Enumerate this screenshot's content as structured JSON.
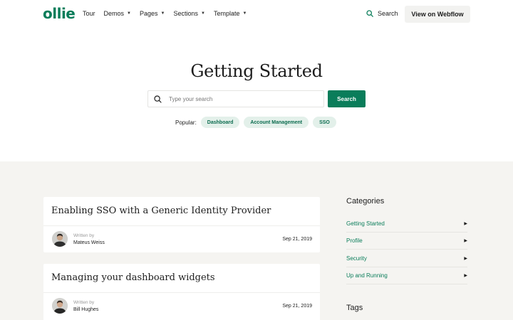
{
  "nav": {
    "logo": "ollie",
    "links": [
      {
        "label": "Tour",
        "dropdown": false
      },
      {
        "label": "Demos",
        "dropdown": true
      },
      {
        "label": "Pages",
        "dropdown": true
      },
      {
        "label": "Sections",
        "dropdown": true
      },
      {
        "label": "Template",
        "dropdown": true
      }
    ],
    "search_label": "Search",
    "cta_label": "View on Webflow"
  },
  "hero": {
    "title": "Getting Started",
    "search_placeholder": "Type your search",
    "search_button": "Search",
    "popular_label": "Popular:",
    "popular_tags": [
      "Dashboard",
      "Account Management",
      "SSO"
    ]
  },
  "articles": [
    {
      "title": "Enabling SSO with a Generic Identity Provider",
      "written_by": "Written by",
      "author": "Mateus Weiss",
      "date": "Sep 21, 2019"
    },
    {
      "title": "Managing your dashboard widgets",
      "written_by": "Written by",
      "author": "Bill Hughes",
      "date": "Sep 21, 2019"
    }
  ],
  "sidebar": {
    "categories_title": "Categories",
    "categories": [
      "Getting Started",
      "Profile",
      "Security",
      "Up and Running"
    ],
    "tags_title": "Tags"
  },
  "colors": {
    "brand": "#0a7d5a",
    "tag_bg": "#e3f0ea",
    "section_bg": "#f5f4f1"
  }
}
